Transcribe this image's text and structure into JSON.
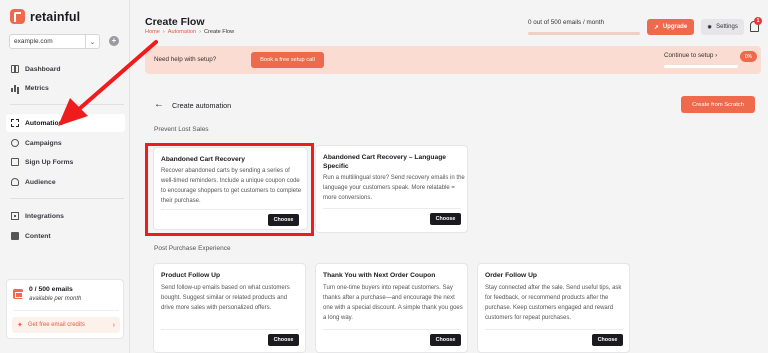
{
  "brand": {
    "name": "retainful"
  },
  "store": {
    "selected": "example.com"
  },
  "sidebar": {
    "items": [
      {
        "label": "Dashboard"
      },
      {
        "label": "Metrics"
      },
      {
        "label": "Automation"
      },
      {
        "label": "Campaigns"
      },
      {
        "label": "Sign Up Forms"
      },
      {
        "label": "Audience"
      },
      {
        "label": "Integrations"
      },
      {
        "label": "Content"
      }
    ],
    "credits": {
      "main": "0 / 500 emails",
      "sub": "available per month",
      "link": "Get free email credits"
    }
  },
  "header": {
    "title": "Create Flow",
    "breadcrumb": [
      "Home",
      "Automation",
      "Create Flow"
    ],
    "usage_text": "0 out of 500 emails / month",
    "usage_fraction": 0,
    "upgrade_label": "Upgrade",
    "settings_label": "Settings",
    "notification_count": "1"
  },
  "banner": {
    "text": "Need help with setup?",
    "button": "Book a free setup call",
    "setup_label": "Continue to setup",
    "setup_percent": "0%"
  },
  "main": {
    "title": "Create automation",
    "scratch_button": "Create from Scratch",
    "groups": [
      {
        "label": "Prevent Lost Sales",
        "cards": [
          {
            "title": "Abandoned Cart Recovery",
            "desc": "Recover abandoned carts by sending a series of well-timed reminders. Include a unique coupon code to encourage shoppers to get customers to complete their purchase.",
            "button": "Choose"
          },
          {
            "title": "Abandoned Cart Recovery – Language Specific",
            "desc": "Run a multilingual store? Send recovery emails in the language your customers speak. More relatable = more conversions.",
            "button": "Choose"
          }
        ]
      },
      {
        "label": "Post Purchase Experience",
        "cards": [
          {
            "title": "Product Follow Up",
            "desc": "Send follow-up emails based on what customers bought. Suggest similar or related products and drive more sales with personalized offers.",
            "button": "Choose"
          },
          {
            "title": "Thank You with Next Order Coupon",
            "desc": "Turn one-time buyers into repeat customers. Say thanks after a purchase—and encourage the next one with a special discount. A simple thank you goes a long way.",
            "button": "Choose"
          },
          {
            "title": "Order Follow Up",
            "desc": "Stay connected after the sale. Send useful tips, ask for feedback, or recommend products after the purchase. Keep customers engaged and reward customers for repeat purchases.",
            "button": "Choose"
          }
        ]
      }
    ]
  },
  "colors": {
    "accent": "#ef6a4c",
    "annotation": "#ee1c1c",
    "banner": "#fbdcd3"
  }
}
